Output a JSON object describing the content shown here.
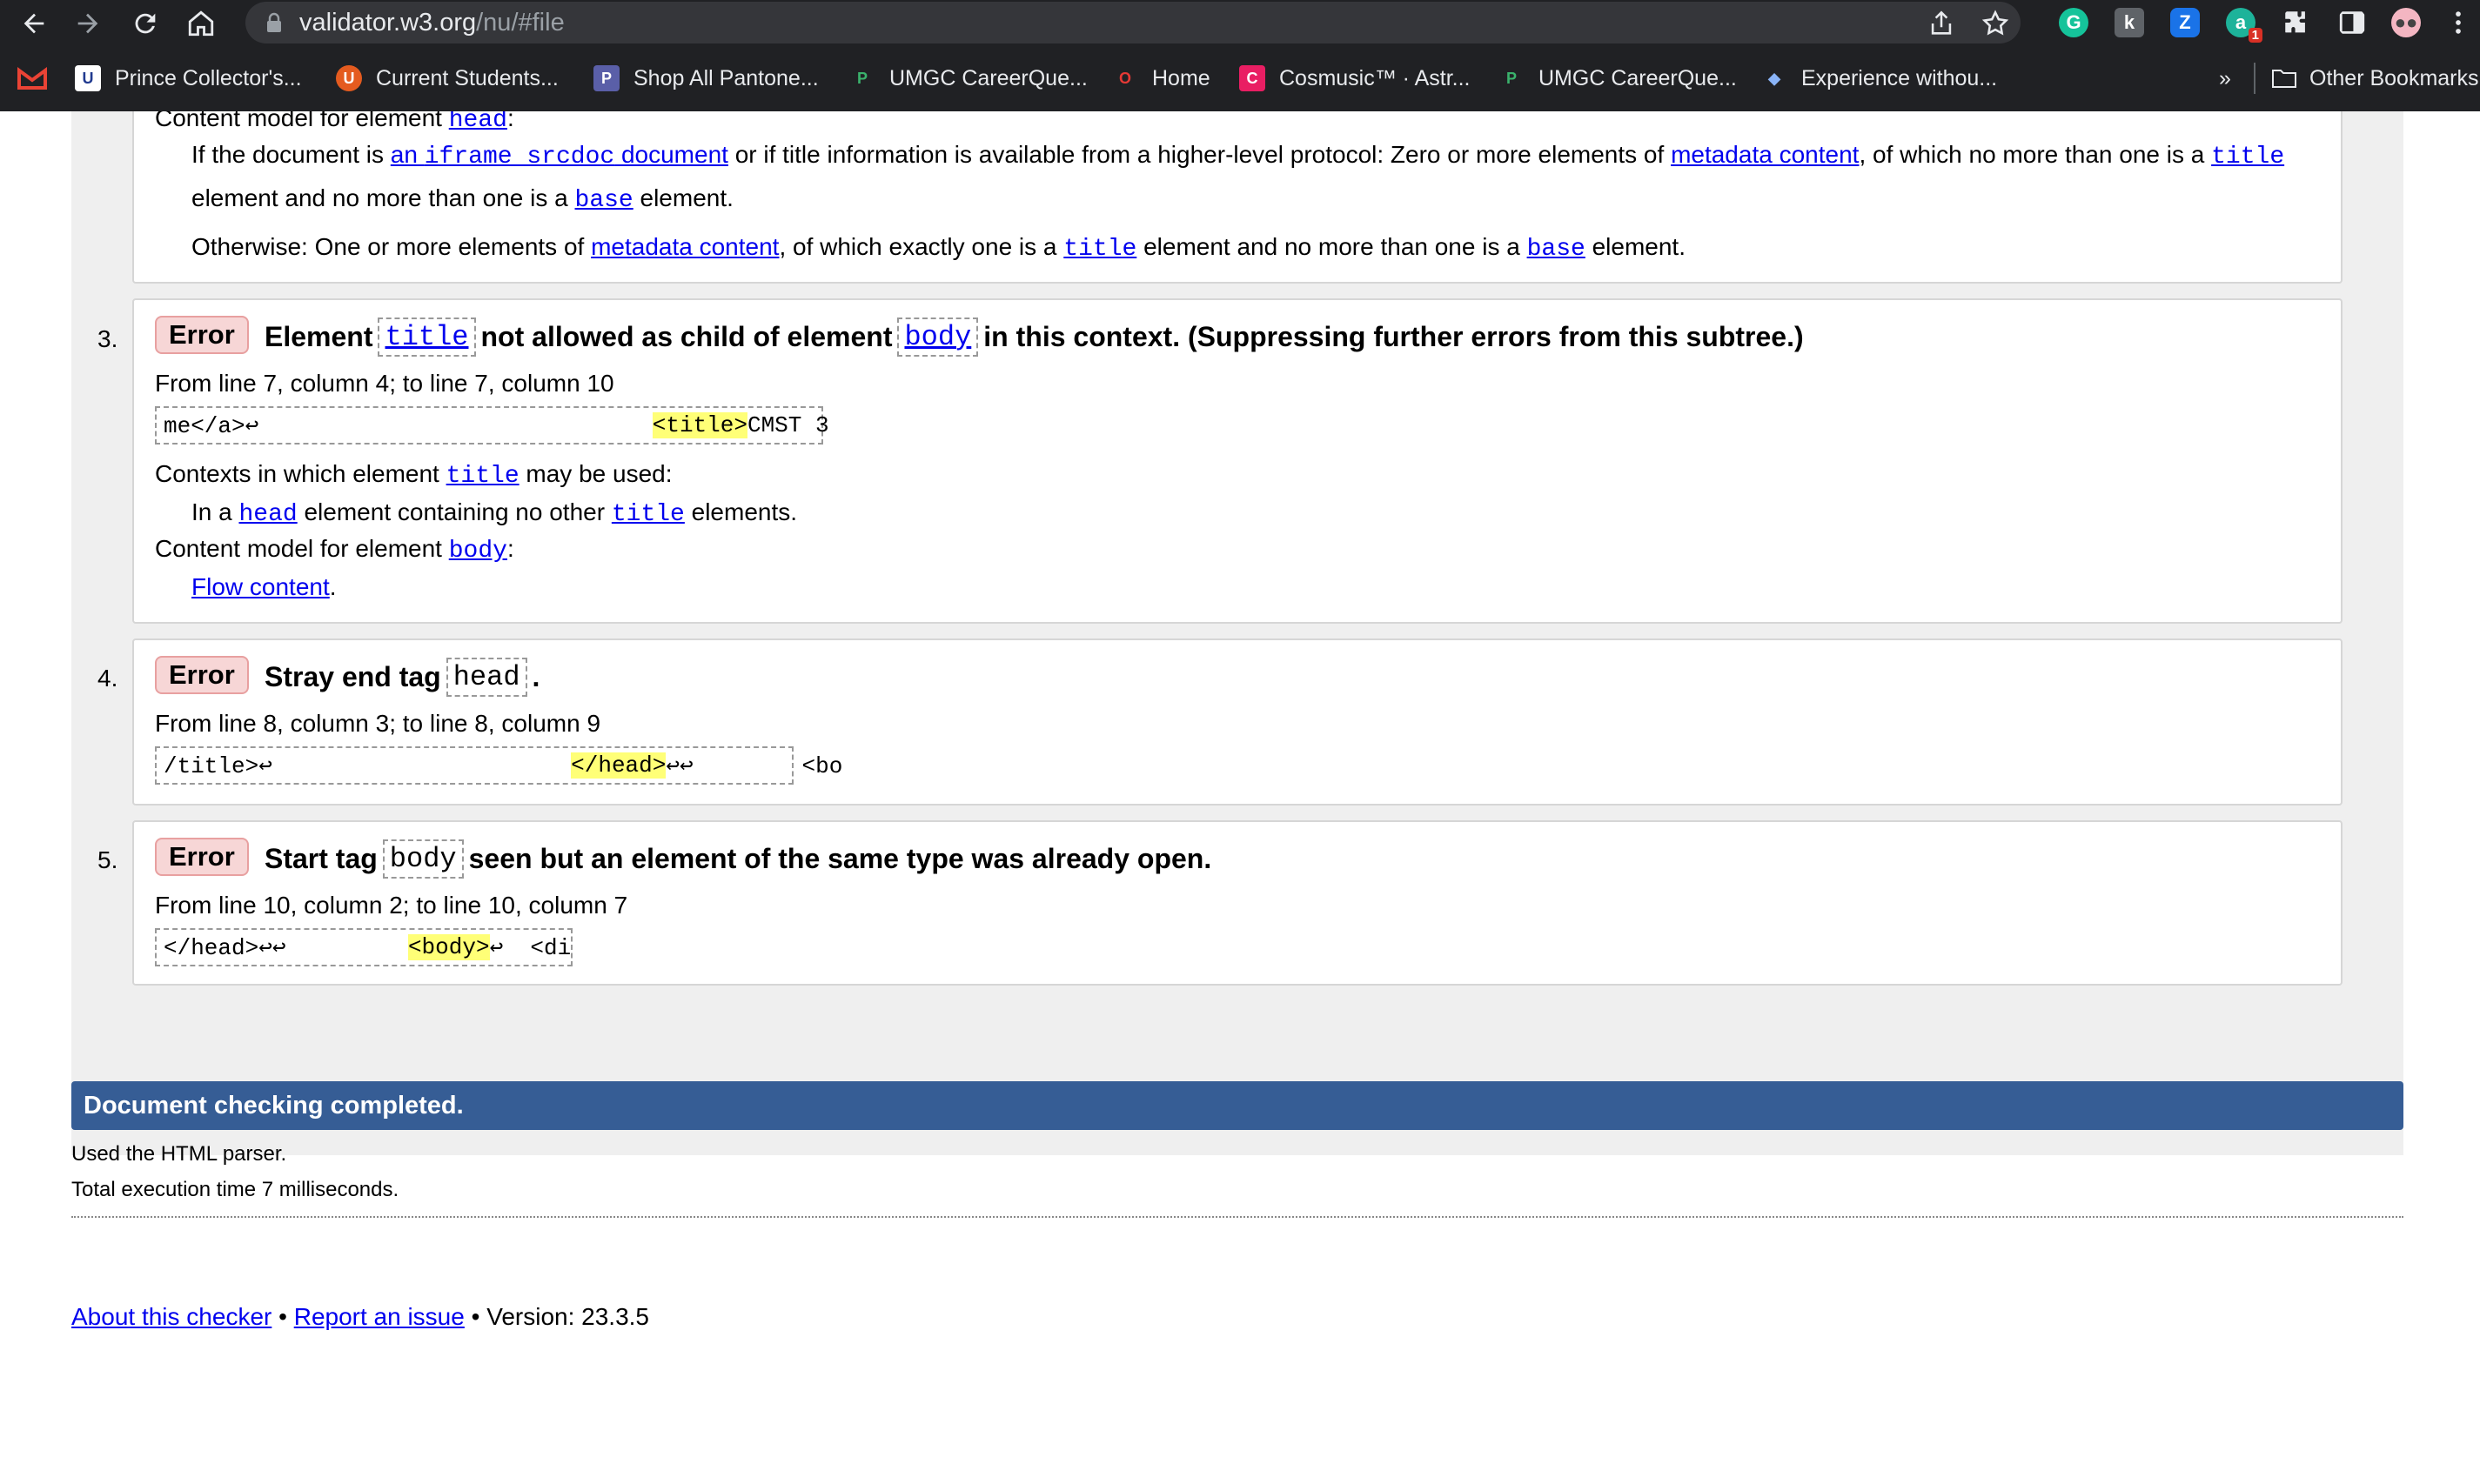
{
  "browser": {
    "url_host": "validator.w3.org",
    "url_path": "/nu/#file",
    "bookmarks": [
      {
        "label": "Prince Collector's...",
        "icon": "uhb-icon"
      },
      {
        "label": "Current Students...",
        "icon": "umgc-icon"
      },
      {
        "label": "Shop All Pantone...",
        "icon": "pantone-icon"
      },
      {
        "label": "UMGC CareerQue...",
        "icon": "careerquest-icon"
      },
      {
        "label": "Home",
        "icon": "home-ring-icon"
      },
      {
        "label": "Cosmusic™ · Astr...",
        "icon": "cosmusic-icon"
      },
      {
        "label": "UMGC CareerQue...",
        "icon": "careerquest-icon"
      },
      {
        "label": "Experience withou...",
        "icon": "diamond-icon"
      }
    ],
    "overflow": "»",
    "other_bookmarks": "Other Bookmarks",
    "ext_badge": "1"
  },
  "top_section": {
    "content_model_prefix": "Content model for element ",
    "content_model_elem": "head",
    "colon": ":",
    "line1_a": "If the document is ",
    "line1_link_a": "an ",
    "line1_link_code": "iframe srcdoc",
    "line1_link_b": " document",
    "line1_b": " or if title information is available from a higher-level protocol: Zero or more elements of ",
    "line1_link2": "metadata content",
    "line1_c": ", of which no more than one is a ",
    "line1_code": "title",
    "line2_a": "element and no more than one is a ",
    "line2_code": "base",
    "line2_b": " element.",
    "line3_a": "Otherwise: One or more elements of ",
    "line3_link": "metadata content",
    "line3_b": ", of which exactly one is a ",
    "line3_code1": "title",
    "line3_c": " element and no more than one is a ",
    "line3_code2": "base",
    "line3_d": " element."
  },
  "errors": [
    {
      "number": "3.",
      "badge": "Error",
      "msg_a": "Element",
      "msg_code1": "title",
      "msg_b": "not allowed as child of element",
      "msg_code2": "body",
      "msg_c": "in this context. (Suppressing further errors from this subtree.)",
      "location": "From line 7, column 4; to line 7, column 10",
      "extract_pre": "me</a>↩                             ",
      "extract_hl": "<title>",
      "extract_post": "CMST 3",
      "ctx_label": "Contexts in which element ",
      "ctx_code": "title",
      "ctx_label_b": " may be used:",
      "ctx_line_a": "In a ",
      "ctx_line_code1": "head",
      "ctx_line_b": " element containing no other ",
      "ctx_line_code2": "title",
      "ctx_line_c": " elements.",
      "cm_label": "Content model for element ",
      "cm_code": "body",
      "cm_colon": ":",
      "cm_link": "Flow content",
      "cm_period": "."
    },
    {
      "number": "4.",
      "badge": "Error",
      "msg_a": "Stray end tag",
      "msg_code1": "head",
      "msg_b": ".",
      "location": "From line 8, column 3; to line 8, column 9",
      "extract_pre": "/title>↩                      ",
      "extract_hl": "</head>",
      "extract_post": "↩↩        <bo"
    },
    {
      "number": "5.",
      "badge": "Error",
      "msg_a": "Start tag",
      "msg_code1": "body",
      "msg_b": "seen but an element of the same type was already open.",
      "location": "From line 10, column 2; to line 10, column 7",
      "extract_pre": "</head>↩↩         ",
      "extract_hl": "<body>",
      "extract_post": "↩  <di"
    }
  ],
  "status": {
    "completed": "Document checking completed.",
    "parser": "Used the HTML parser.",
    "time": "Total execution time 7 milliseconds."
  },
  "footer": {
    "about": "About this checker",
    "sep1": " • ",
    "report": "Report an issue",
    "version": " • Version: 23.3.5"
  }
}
